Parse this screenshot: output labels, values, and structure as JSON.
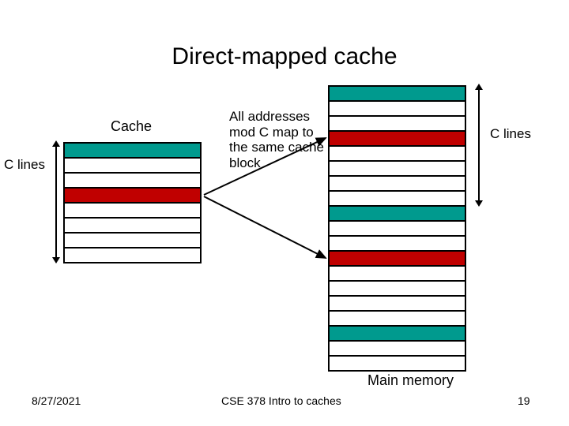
{
  "title": "Direct-mapped cache",
  "cache_label": "Cache",
  "explain_text": "All addresses mod C map to the same cache block",
  "c_lines_label": "C lines",
  "main_memory_label": "Main memory",
  "footer": {
    "date": "8/27/2021",
    "center": "CSE 378 Intro to caches",
    "page": "19"
  },
  "colors": {
    "teal": "#009a8e",
    "red": "#c00000"
  },
  "cache_rows": [
    "teal",
    "white",
    "white",
    "red",
    "white",
    "white",
    "white",
    "white"
  ],
  "memory_rows": [
    "teal",
    "white",
    "white",
    "red",
    "white",
    "white",
    "white",
    "white",
    "teal",
    "white",
    "white",
    "red",
    "white",
    "white",
    "white",
    "white",
    "teal",
    "white",
    "white"
  ],
  "chart_data": {
    "type": "table",
    "title": "Direct-mapped cache",
    "cache": {
      "lines": 8,
      "label": "Cache",
      "axis_label": "C lines",
      "highlights": [
        {
          "index": 0,
          "color": "teal"
        },
        {
          "index": 3,
          "color": "red"
        }
      ]
    },
    "main_memory": {
      "lines": 19,
      "label": "Main memory",
      "c_lines_span": [
        0,
        7
      ],
      "highlights": [
        {
          "index": 0,
          "color": "teal"
        },
        {
          "index": 3,
          "color": "red"
        },
        {
          "index": 8,
          "color": "teal"
        },
        {
          "index": 11,
          "color": "red"
        },
        {
          "index": 16,
          "color": "teal"
        }
      ]
    },
    "mapping_note": "All addresses mod C map to the same cache block",
    "mapping_arrows": [
      {
        "from_cache_row": 3,
        "to_memory_rows": [
          3,
          11
        ]
      }
    ]
  }
}
